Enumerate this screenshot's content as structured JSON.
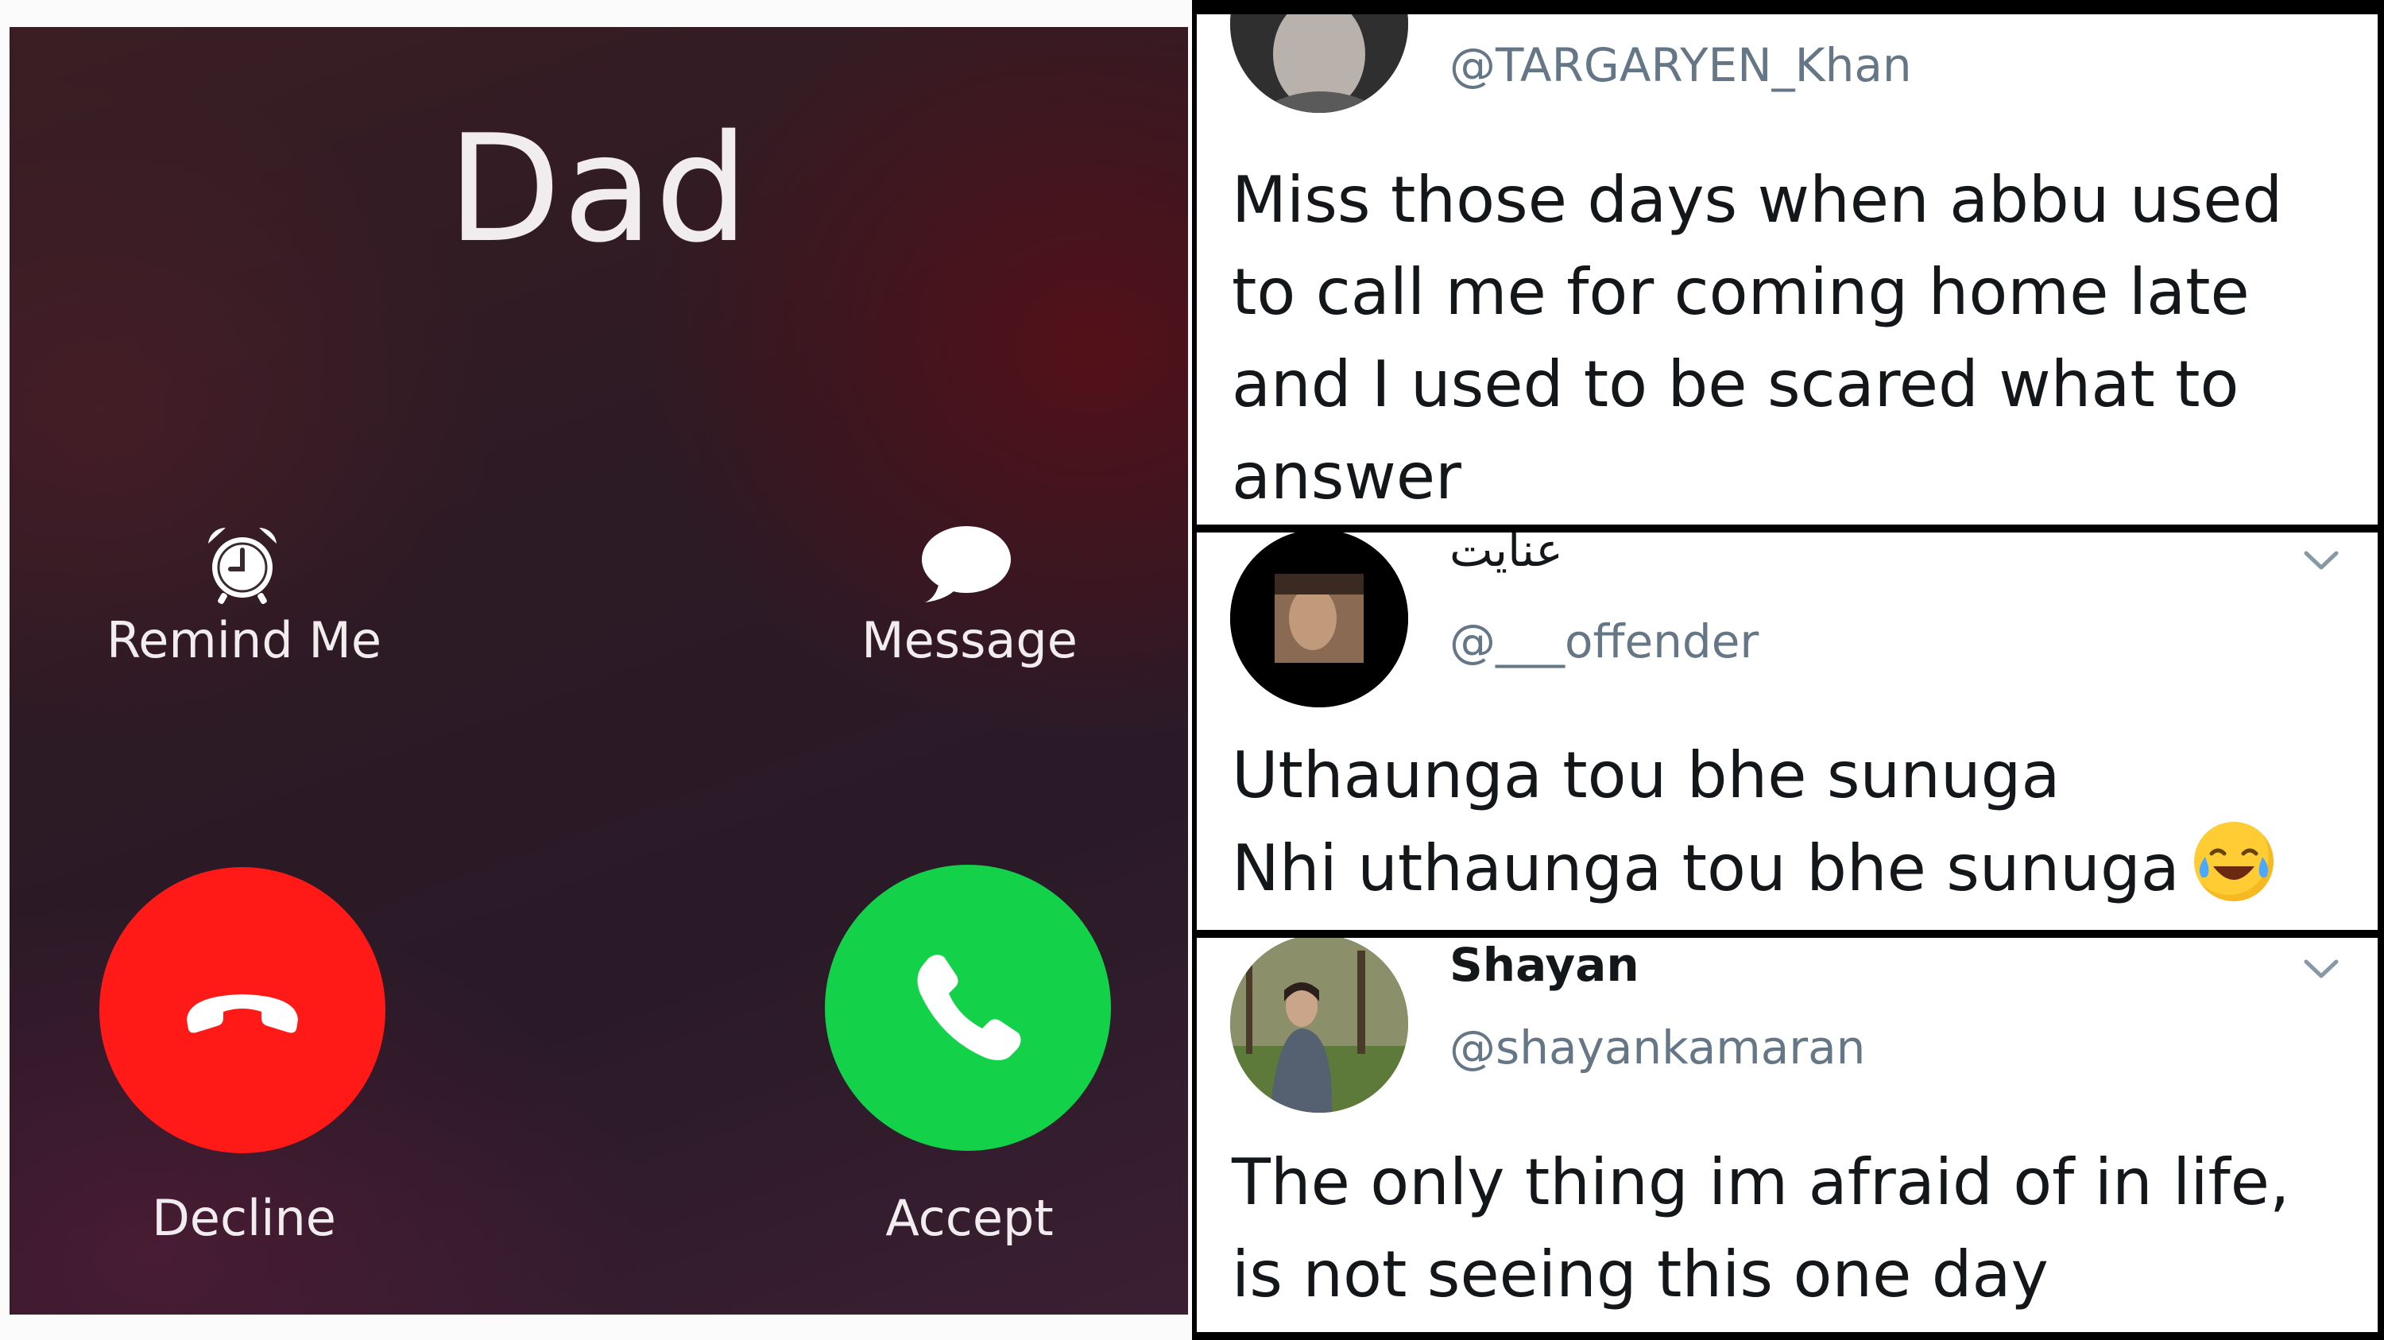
{
  "call": {
    "caller_name": "Dad",
    "remind_label": "Remind Me",
    "message_label": "Message",
    "decline_label": "Decline",
    "accept_label": "Accept",
    "icons": {
      "remind": "alarm-clock-icon",
      "message": "speech-bubble-icon",
      "decline": "phone-hangup-icon",
      "accept": "phone-icon"
    },
    "colors": {
      "decline": "#ff1a18",
      "accept": "#14d14a"
    }
  },
  "tweets": [
    {
      "handle": "@TARGARYEN_Khan",
      "text_lines": [
        "Miss those days when abbu used",
        "to call me for coming home late",
        "and I used to be scared what to",
        "answer"
      ]
    },
    {
      "display_name": "عنايت",
      "handle": "@___offender",
      "text_lines": [
        "Uthaunga tou bhe sunuga",
        "Nhi uthaunga tou bhe sunuga"
      ],
      "emoji": "tears-of-joy-emoji"
    },
    {
      "display_name": "Shayan",
      "handle": "@shayankamaran",
      "text_lines": [
        "The only thing im afraid of in life,",
        "is not seeing this one day"
      ]
    }
  ]
}
